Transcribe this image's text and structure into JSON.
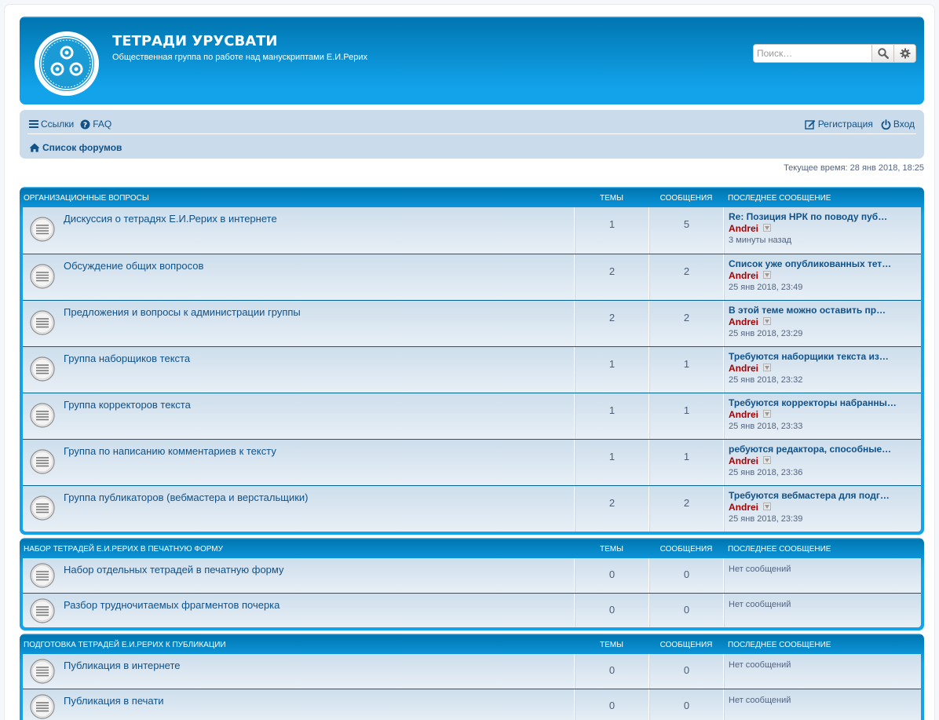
{
  "header": {
    "site_title": "ТЕТРАДИ УРУСВАТИ",
    "site_description": "Общественная группа по работе над манускриптами Е.И.Рерих",
    "search_placeholder": "Поиск…"
  },
  "navbar": {
    "links_label": "Ссылки",
    "faq_label": "FAQ",
    "register_label": "Регистрация",
    "login_label": "Вход",
    "breadcrumb_label": "Список форумов"
  },
  "current_time": "Текущее время: 28 янв 2018, 18:25",
  "categories": [
    {
      "title": "ОРГАНИЗАЦИОННЫЕ ВОПРОСЫ",
      "col_topics": "ТЕМЫ",
      "col_posts": "СООБЩЕНИЯ",
      "col_last": "ПОСЛЕДНЕЕ СООБЩЕНИЕ",
      "forums": [
        {
          "title": "Дискуссия о тетрадях Е.И.Рерих в интернете",
          "topics": "1",
          "posts": "5",
          "last_title": "Re: Позиция НРК по поводу пуб…",
          "last_author": "Andrei",
          "last_time": "3 минуты назад"
        },
        {
          "title": "Обсуждение общих вопросов",
          "topics": "2",
          "posts": "2",
          "last_title": "Список уже опубликованных тет…",
          "last_author": "Andrei",
          "last_time": "25 янв 2018, 23:49"
        },
        {
          "title": "Предложения и вопросы к администрации группы",
          "topics": "2",
          "posts": "2",
          "last_title": "В этой теме можно оставить пр…",
          "last_author": "Andrei",
          "last_time": "25 янв 2018, 23:29"
        },
        {
          "title": "Группа наборщиков текста",
          "topics": "1",
          "posts": "1",
          "last_title": "Требуются наборщики текста из…",
          "last_author": "Andrei",
          "last_time": "25 янв 2018, 23:32"
        },
        {
          "title": "Группа корректоров текста",
          "topics": "1",
          "posts": "1",
          "last_title": "Требуются корректоры набранны…",
          "last_author": "Andrei",
          "last_time": "25 янв 2018, 23:33"
        },
        {
          "title": "Группа по написанию комментариев к тексту",
          "topics": "1",
          "posts": "1",
          "last_title": "ребуются редактора, способные…",
          "last_author": "Andrei",
          "last_time": "25 янв 2018, 23:36"
        },
        {
          "title": "Группа публикаторов (вебмастера и верстальщики)",
          "topics": "2",
          "posts": "2",
          "last_title": "Требуются вебмастера для подг…",
          "last_author": "Andrei",
          "last_time": "25 янв 2018, 23:39"
        }
      ]
    },
    {
      "title": "НАБОР ТЕТРАДЕЙ Е.И.РЕРИХ В ПЕЧАТНУЮ ФОРМУ",
      "col_topics": "ТЕМЫ",
      "col_posts": "СООБЩЕНИЯ",
      "col_last": "ПОСЛЕДНЕЕ СООБЩЕНИЕ",
      "forums": [
        {
          "title": "Набор отдельных тетрадей в печатную форму",
          "topics": "0",
          "posts": "0",
          "no_posts": "Нет сообщений"
        },
        {
          "title": "Разбор трудночитаемых фрагментов почерка",
          "topics": "0",
          "posts": "0",
          "no_posts": "Нет сообщений"
        }
      ]
    },
    {
      "title": "ПОДГОТОВКА ТЕТРАДЕЙ Е.И.РЕРИХ К ПУБЛИКАЦИИ",
      "col_topics": "ТЕМЫ",
      "col_posts": "СООБЩЕНИЯ",
      "col_last": "ПОСЛЕДНЕЕ СООБЩЕНИЕ",
      "forums": [
        {
          "title": "Публикация в интернете",
          "topics": "0",
          "posts": "0",
          "no_posts": "Нет сообщений"
        },
        {
          "title": "Публикация в печати",
          "topics": "0",
          "posts": "0",
          "no_posts": "Нет сообщений"
        }
      ]
    }
  ],
  "colors": {
    "header_blue": "#12a3eb",
    "link_blue": "#105289",
    "author_red": "#aa0000",
    "navbar_bg": "#cadceb"
  }
}
